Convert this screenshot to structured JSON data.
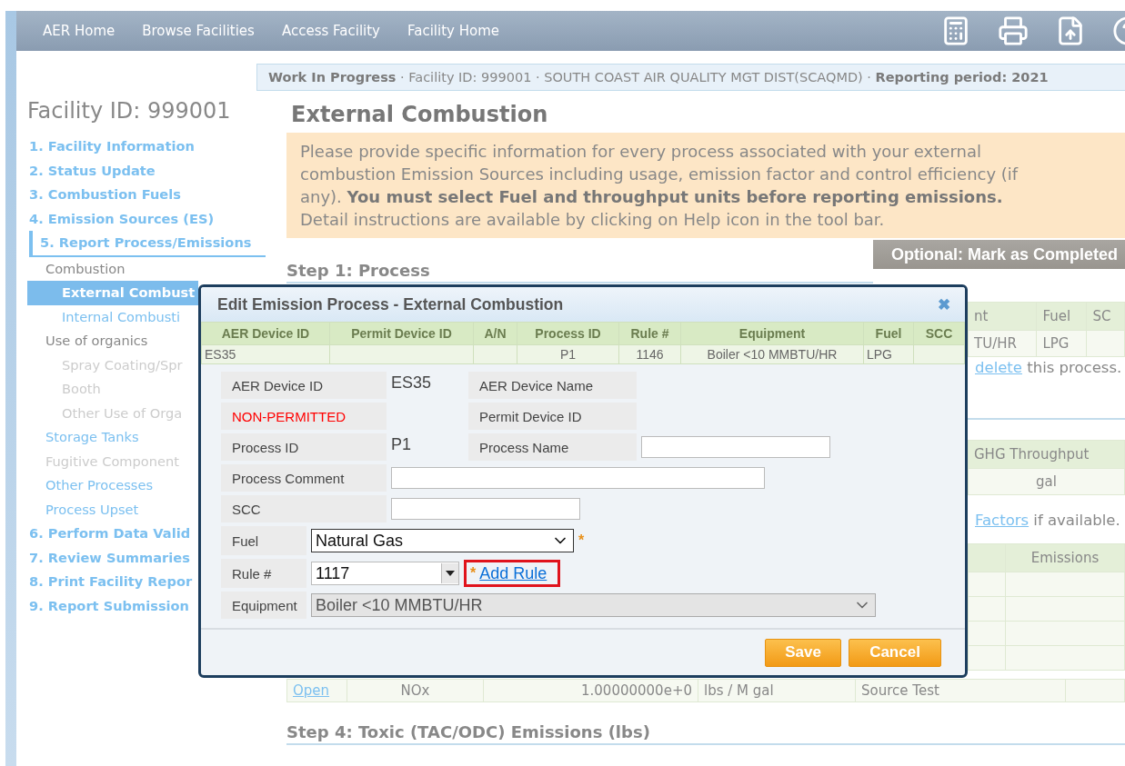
{
  "nav": {
    "links": [
      "AER Home",
      "Browse Facilities",
      "Access Facility",
      "Facility Home"
    ]
  },
  "status_banner": "**Work In Progress** · Facility ID: 999001 · SOUTH COAST AIR QUALITY MGT DIST(SCAQMD) · **Reporting period: 2021**",
  "sidebar": {
    "title": "Facility ID: 999001",
    "items": [
      {
        "label": "1. Facility Information",
        "kind": "step",
        "selected": false,
        "disabled": false
      },
      {
        "label": "2. Status Update",
        "kind": "step",
        "selected": false,
        "disabled": false
      },
      {
        "label": "3. Combustion Fuels",
        "kind": "step",
        "selected": false,
        "disabled": false
      },
      {
        "label": "4. Emission Sources (ES)",
        "kind": "step",
        "selected": false,
        "disabled": false
      },
      {
        "label": "5. Report Process/Emissions",
        "kind": "step",
        "selected": true,
        "disabled": false
      },
      {
        "label": "Combustion",
        "kind": "group",
        "selected": false,
        "disabled": false
      },
      {
        "label": "External Combust",
        "kind": "sub",
        "selected": true,
        "disabled": false
      },
      {
        "label": "Internal Combusti",
        "kind": "sub",
        "selected": false,
        "disabled": false
      },
      {
        "label": "Use of organics",
        "kind": "group",
        "selected": false,
        "disabled": false
      },
      {
        "label": "Spray Coating/Spr\nBooth",
        "kind": "sub",
        "selected": false,
        "disabled": true
      },
      {
        "label": "Other Use of Orga",
        "kind": "sub",
        "selected": false,
        "disabled": true
      },
      {
        "label": "Storage Tanks",
        "kind": "link",
        "selected": false,
        "disabled": false
      },
      {
        "label": "Fugitive Component",
        "kind": "link",
        "selected": false,
        "disabled": true
      },
      {
        "label": "Other Processes",
        "kind": "link",
        "selected": false,
        "disabled": false
      },
      {
        "label": "Process Upset",
        "kind": "link",
        "selected": false,
        "disabled": false
      },
      {
        "label": "6. Perform Data Valid",
        "kind": "step",
        "selected": false,
        "disabled": false
      },
      {
        "label": "7. Review Summaries",
        "kind": "step",
        "selected": false,
        "disabled": false
      },
      {
        "label": "8. Print Facility Repor",
        "kind": "step",
        "selected": false,
        "disabled": false
      },
      {
        "label": "9. Report Submission",
        "kind": "step",
        "selected": false,
        "disabled": false
      }
    ]
  },
  "page_title": "External Combustion",
  "notice": "Please provide specific information for every process associated with your external combustion Emission Sources including usage, emission factor and control efficiency (if any). **You must select Fuel and throughput units before reporting emissions.** Detail instructions are available by clicking on Help icon in the tool bar.",
  "step1": {
    "heading": "Step 1: Process",
    "button": "Optional: Mark as Completed"
  },
  "behind_dialog": {
    "process_table": {
      "columns": [
        "nt",
        "Fuel",
        "SC"
      ],
      "row": [
        "TU/HR",
        "LPG"
      ]
    },
    "delete_note": {
      "link": "delete",
      "text": " this process."
    },
    "throughput_table": {
      "columns": [
        "GHG Throughput"
      ],
      "row": [
        "gal"
      ]
    },
    "factors_note": {
      "link": "Factors",
      "text": " if available."
    },
    "emissions_table": {
      "columns": [
        null,
        "Emissions"
      ]
    }
  },
  "emission_row": [
    "Open",
    "NOx",
    "1.00000000e+0",
    "lbs / M gal",
    "Source Test"
  ],
  "step4": {
    "heading": "Step 4: Toxic (TAC/ODC) Emissions (lbs)"
  },
  "dialog": {
    "title": "Edit Emission Process - External Combustion",
    "close": "✖",
    "summary": {
      "columns": [
        "AER Device ID",
        "Permit Device ID",
        "A/N",
        "Process ID",
        "Rule #",
        "Equipment",
        "Fuel",
        "SCC"
      ],
      "row": {
        "aer_device_id": "ES35",
        "process_id": "P1",
        "rule": "1146",
        "equipment": "Boiler <10 MMBTU/HR",
        "fuel": "LPG"
      }
    },
    "fields": [
      {
        "kind": "info",
        "label": "AER Device ID",
        "value": "ES35",
        "label2": "AER Device Name",
        "warning": false
      },
      {
        "kind": "info",
        "label": "NON-PERMITTED",
        "label2": "Permit Device ID",
        "warning": true
      },
      {
        "kind": "info",
        "label": "Process ID",
        "value": "P1",
        "label2": "Process Name",
        "warning": false,
        "field2": true
      },
      {
        "kind": "input",
        "label": "Process Comment"
      },
      {
        "kind": "input",
        "label": "SCC"
      },
      {
        "kind": "select",
        "label": "Fuel",
        "value": "Natural Gas",
        "required": "*",
        "disabled": false
      },
      {
        "kind": "combo",
        "label": "Rule #",
        "value": "1117",
        "required": "*",
        "link": "Add Rule",
        "highlighted": true
      },
      {
        "kind": "select",
        "label": "Equipment",
        "value": "Boiler <10 MMBTU/HR",
        "disabled": true
      }
    ],
    "buttons": [
      "Save",
      "Cancel"
    ]
  }
}
